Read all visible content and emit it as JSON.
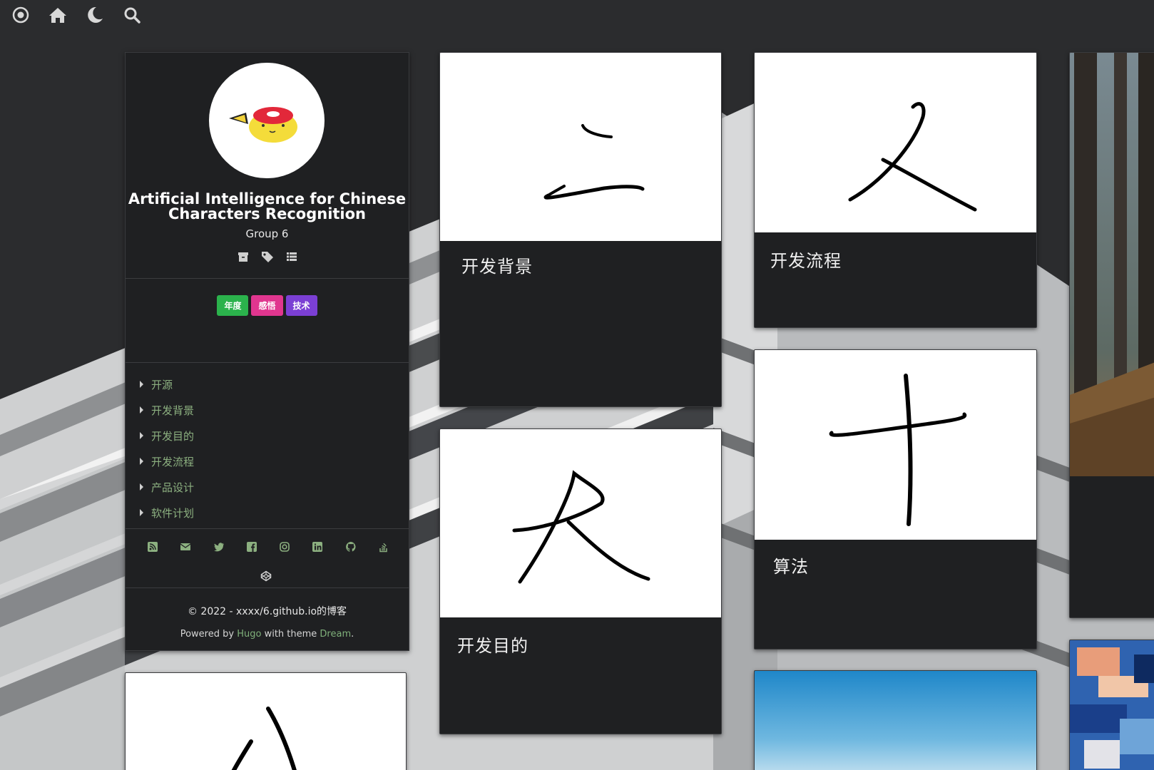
{
  "nav": {
    "icons": [
      "target-icon",
      "home-icon",
      "moon-icon",
      "search-icon"
    ]
  },
  "profile": {
    "title_line1": "Artificial Intelligence for Chinese",
    "title_line2": "Characters Recognition",
    "subtitle": "Group 6",
    "meta_icons": [
      "archive-icon",
      "tags-icon",
      "list-icon"
    ],
    "tags": [
      {
        "label": "年度",
        "color": "#2bb24c"
      },
      {
        "label": "感悟",
        "color": "#e0368f"
      },
      {
        "label": "技术",
        "color": "#7b3fd4"
      }
    ],
    "menu": [
      "开源",
      "开发背景",
      "开发目的",
      "开发流程",
      "产品设计",
      "软件计划"
    ],
    "social_icons": [
      "rss-icon",
      "email-icon",
      "twitter-icon",
      "facebook-icon",
      "instagram-icon",
      "linkedin-icon",
      "github-icon",
      "stackoverflow-icon",
      "codepen-icon"
    ],
    "copyright": "© 2022 -  xxxx/6.github.io的博客",
    "powered_prefix": "Powered by ",
    "powered_hugo": "Hugo",
    "powered_mid": " with theme ",
    "powered_dream": "Dream",
    "powered_suffix": "."
  },
  "cards": [
    {
      "title": "开发背景",
      "glyph": "二"
    },
    {
      "title": "开发流程",
      "glyph": "入"
    },
    {
      "title": "开发目的",
      "glyph": "大"
    },
    {
      "title": "算法",
      "glyph": "十"
    },
    {
      "title": "",
      "glyph": "八"
    }
  ],
  "colors": {
    "page_bg": "#2b2c2e",
    "card_bg": "#1f2022",
    "link_green": "#8cb080"
  }
}
